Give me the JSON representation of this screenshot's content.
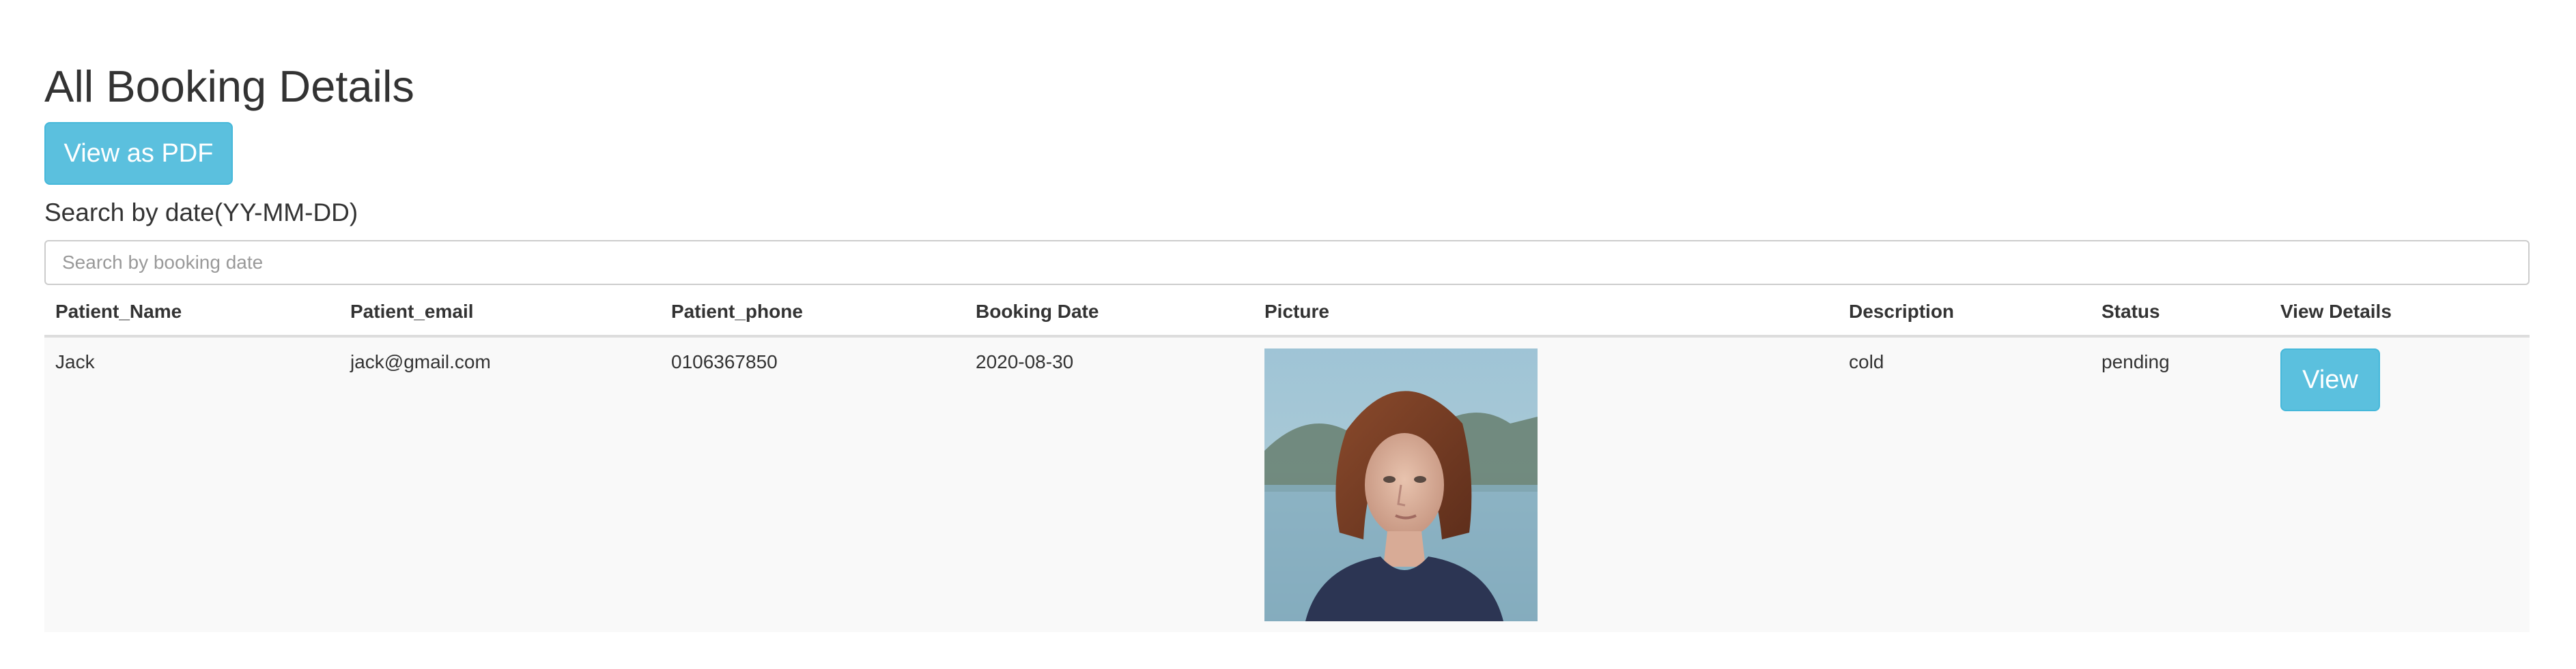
{
  "page": {
    "title": "All Booking Details",
    "pdf_button_label": "View as PDF",
    "search_label": "Search by date(YY-MM-DD)",
    "search_placeholder": "Search by booking date",
    "search_value": ""
  },
  "table": {
    "columns": [
      "Patient_Name",
      "Patient_email",
      "Patient_phone",
      "Booking Date",
      "Picture",
      "Description",
      "Status",
      "View Details"
    ],
    "rows": [
      {
        "name": "Jack",
        "email": "jack@gmail.com",
        "phone": "0106367850",
        "booking_date": "2020-08-30",
        "picture": "patient-photo",
        "description": "cold",
        "status": "pending",
        "view_label": "View"
      }
    ]
  },
  "colors": {
    "accent_button": "#5bc0de",
    "accent_button_border": "#46b8da",
    "row_background": "#f9f9f9",
    "header_border": "#dddddd"
  }
}
